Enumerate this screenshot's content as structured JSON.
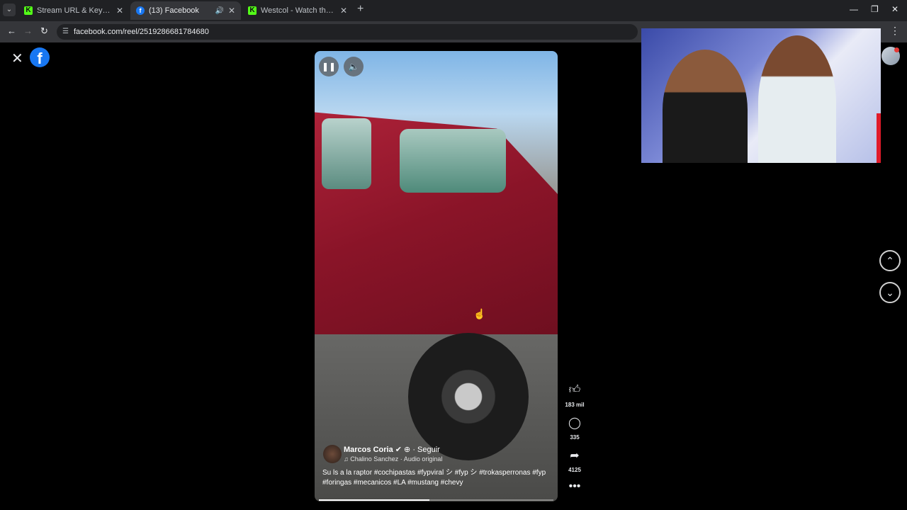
{
  "browser": {
    "tabs": [
      {
        "title": "Stream URL & Key - Kick Dashb",
        "favicon": "kick-icon",
        "active": false
      },
      {
        "title": "(13) Facebook",
        "favicon": "facebook-icon",
        "active": true,
        "audio": true
      },
      {
        "title": "Westcol - Watch the VOD on Ki",
        "favicon": "kick-icon",
        "active": false
      }
    ],
    "address": "facebook.com/reel/2519286681784680"
  },
  "reel": {
    "author": "Marcos Coria",
    "follow_label": "· Seguir",
    "audio": "Chalino Sanchez · Audio original",
    "caption": "Su ls a la raptor   #cochipastas #fypviral シ #fyp シ #trokasperronas #fyp #foringas #mecanicos #LA #mustang #chevy",
    "progress": 0.47
  },
  "actions": {
    "likes": "183 mil",
    "comments": "335",
    "shares": "4125"
  },
  "colors": {
    "facebook_blue": "#1877f2",
    "kick_green": "#53fc18",
    "bg": "#000000"
  }
}
